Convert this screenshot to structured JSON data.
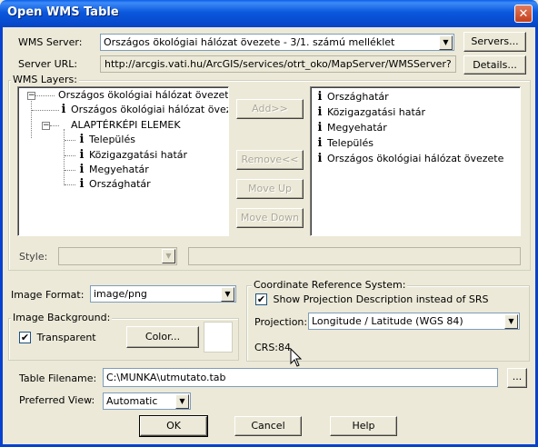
{
  "window": {
    "title": "Open WMS Table",
    "close_label": "✕"
  },
  "server": {
    "label": "WMS Server:",
    "value": "Országos ökológiai hálózat övezete - 3/1. számú melléklet",
    "servers_button": "Servers...",
    "url_label": "Server URL:",
    "url_value": "http://arcgis.vati.hu/ArcGIS/services/otrt_oko/MapServer/WMSServer?",
    "details_button": "Details..."
  },
  "layers": {
    "group_label": "WMS Layers:",
    "tree": {
      "root": "Országos ökológiai hálózat övezete",
      "child1": "Országos ökológiai hálózat övezete",
      "group": "ALAPTÉRKÉPI ELEMEK",
      "sub": [
        "Település",
        "Közigazgatási határ",
        "Megyehatár",
        "Országhatár"
      ]
    },
    "add_button": "Add>>",
    "remove_button": "Remove<<",
    "move_up_button": "Move Up",
    "move_down_button": "Move Down",
    "selected": [
      "Országhatár",
      "Közigazgatási határ",
      "Megyehatár",
      "Település",
      "Országos ökológiai hálózat övezete"
    ],
    "style_label": "Style:",
    "style_value": "",
    "style_desc": ""
  },
  "image_format": {
    "label": "Image Format:",
    "value": "image/png"
  },
  "image_background": {
    "group_label": "Image Background:",
    "transparent_label": "Transparent",
    "transparent_checked": "✔",
    "color_button": "Color...",
    "color_swatch": "#ffffff"
  },
  "crs": {
    "group_label": "Coordinate Reference System:",
    "show_desc_label": "Show Projection Description instead of SRS",
    "show_desc_checked": "✔",
    "projection_label": "Projection:",
    "projection_value": "Longitude / Latitude (WGS 84)",
    "crs_text": "CRS:84"
  },
  "table": {
    "filename_label": "Table Filename:",
    "filename_value": "C:\\MUNKA\\utmutato.tab",
    "browse_button": "...",
    "view_label": "Preferred View:",
    "view_value": "Automatic"
  },
  "footer": {
    "ok": "OK",
    "cancel": "Cancel",
    "help": "Help"
  },
  "icons": {
    "dropdown": "▼",
    "expand_minus": "−",
    "info": "i"
  }
}
